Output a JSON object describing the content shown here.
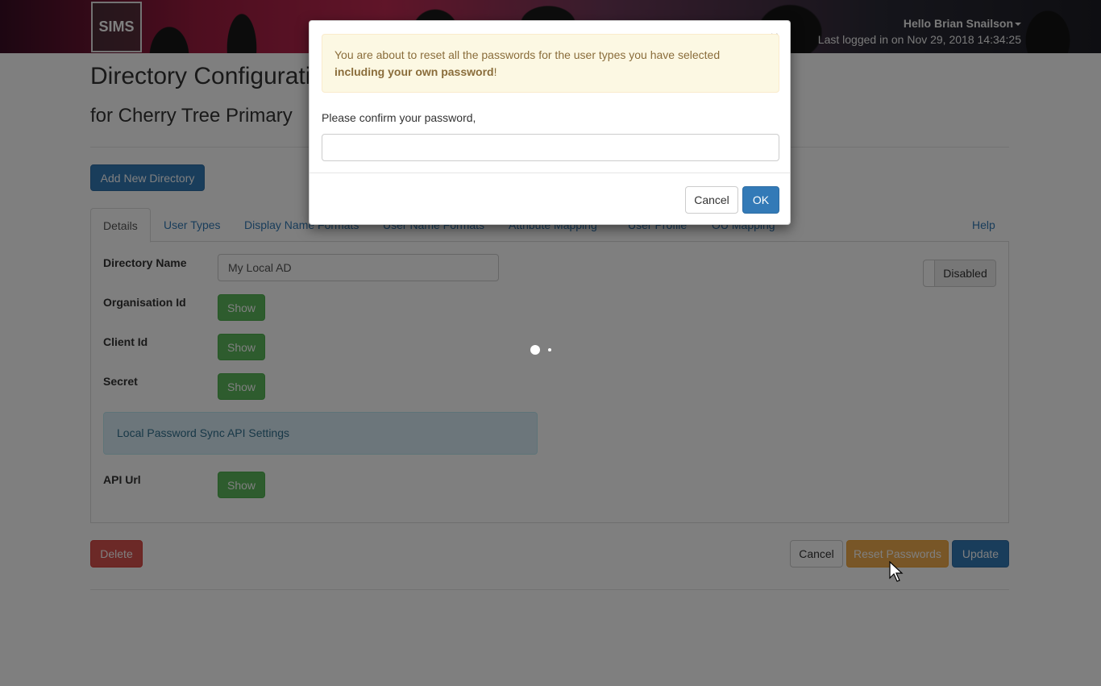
{
  "header": {
    "logo": "SIMS",
    "greeting": "Hello Brian Snailson",
    "last_login": "Last logged in on Nov 29, 2018 14:34:25"
  },
  "page": {
    "title": "Directory Configuration for My Local AD",
    "subtitle": "for Cherry Tree Primary",
    "add_button": "Add New Directory"
  },
  "tabs": [
    {
      "label": "Details"
    },
    {
      "label": "User Types"
    },
    {
      "label": "Display Name Formats"
    },
    {
      "label": "User Name Formats"
    },
    {
      "label": "Attribute Mapping"
    },
    {
      "label": "User Profile"
    },
    {
      "label": "OU Mapping"
    },
    {
      "label": "Help"
    }
  ],
  "details": {
    "directory_name_label": "Directory Name",
    "directory_name_value": "My Local AD",
    "organisation_id_label": "Organisation Id",
    "client_id_label": "Client Id",
    "secret_label": "Secret",
    "show_label": "Show",
    "info_box": "Local Password Sync API Settings",
    "api_url_label": "API Url",
    "toggle_label": "Disabled"
  },
  "footer_buttons": {
    "delete": "Delete",
    "cancel": "Cancel",
    "reset": "Reset Passwords",
    "update": "Update"
  },
  "modal": {
    "close": "×",
    "alert_text": "You are about to reset all the passwords for the user types you have selected ",
    "alert_bold": "including your own password",
    "alert_end": "!",
    "prompt": "Please confirm your password,",
    "password_value": "",
    "cancel": "Cancel",
    "ok": "OK"
  }
}
